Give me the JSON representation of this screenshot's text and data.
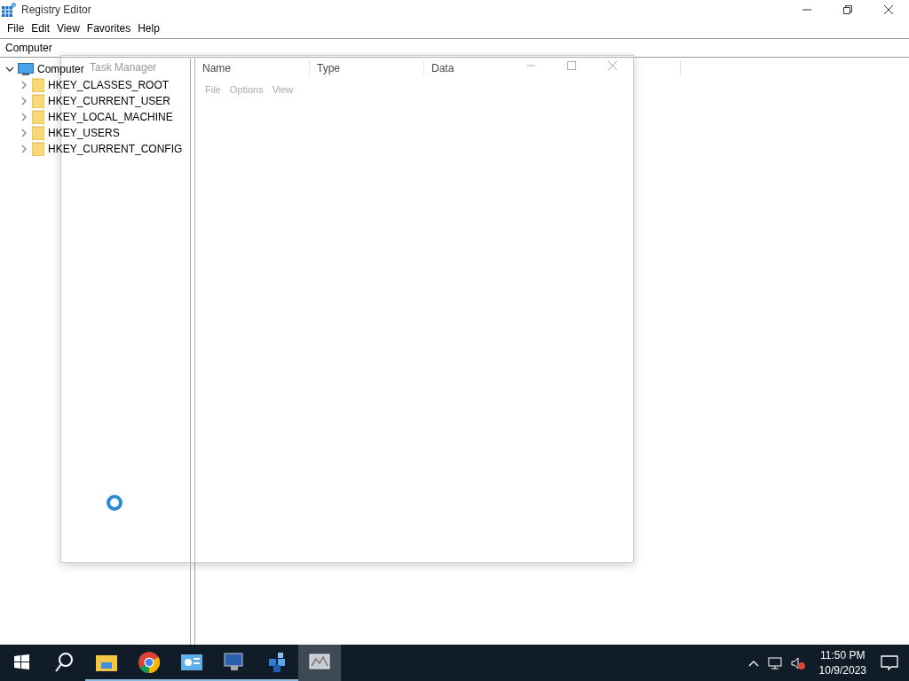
{
  "window": {
    "title": "Registry Editor"
  },
  "menu": [
    "File",
    "Edit",
    "View",
    "Favorites",
    "Help"
  ],
  "address": "Computer",
  "tree": {
    "label": "Computer",
    "expanded": true,
    "children": [
      {
        "label": "HKEY_CLASSES_ROOT",
        "expanded": false
      },
      {
        "label": "HKEY_CURRENT_USER",
        "expanded": false
      },
      {
        "label": "HKEY_LOCAL_MACHINE",
        "expanded": false
      },
      {
        "label": "HKEY_USERS",
        "expanded": false
      },
      {
        "label": "HKEY_CURRENT_CONFIG",
        "expanded": false
      }
    ]
  },
  "columns": [
    "Name",
    "Type",
    "Data"
  ],
  "overlay_window": {
    "title": "Task Manager",
    "menu": [
      "File",
      "Options",
      "View"
    ],
    "loading": true
  },
  "taskbar": {
    "apps": [
      {
        "kind": "folder",
        "running": true,
        "active": false
      },
      {
        "kind": "browser",
        "running": true,
        "active": false
      },
      {
        "kind": "panel",
        "running": true,
        "active": false
      },
      {
        "kind": "monitor",
        "running": true,
        "active": false
      },
      {
        "kind": "cubes",
        "running": true,
        "active": false
      },
      {
        "kind": "chart",
        "running": false,
        "active": true
      }
    ],
    "time": "11:50 PM",
    "date": "10/9/2023"
  }
}
